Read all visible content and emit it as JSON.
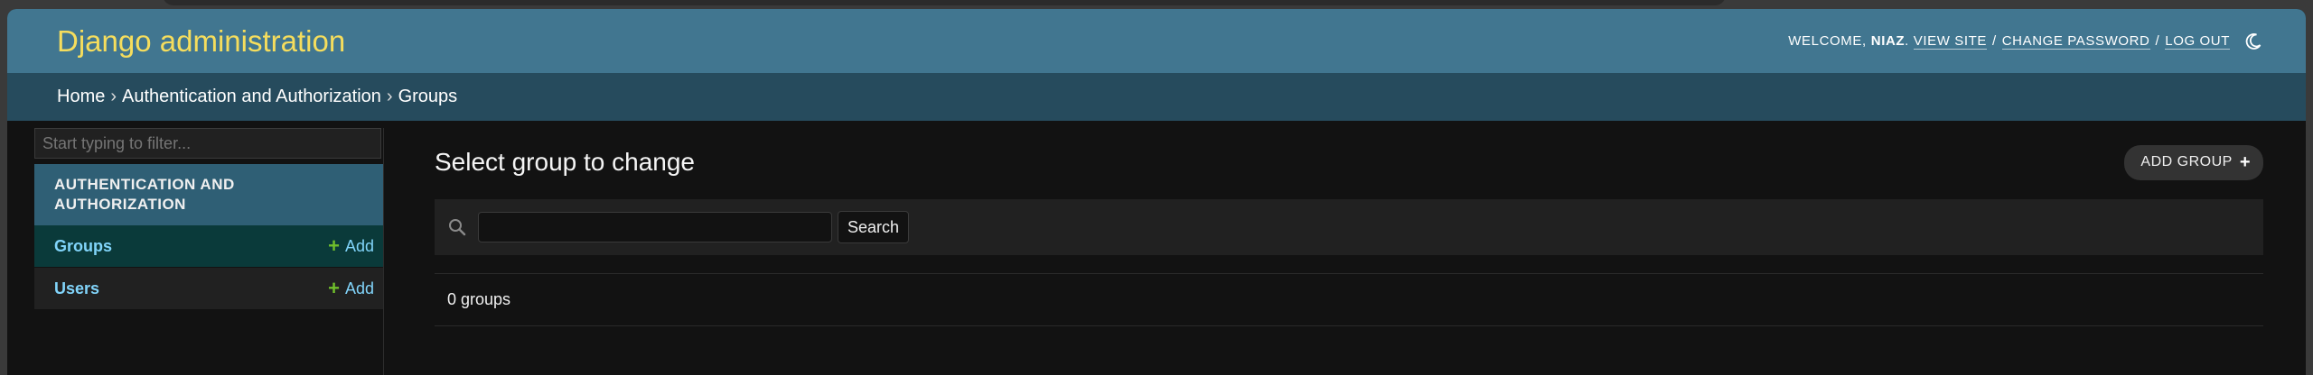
{
  "header": {
    "brand": "Django administration",
    "welcome": "Welcome,",
    "username": "niaz",
    "view_site": "View site",
    "change_password": "Change password",
    "log_out": "Log out",
    "sep1": "/",
    "sep2": "/"
  },
  "breadcrumbs": {
    "home": "Home",
    "app": "Authentication and Authorization",
    "current": "Groups",
    "arrow": "›"
  },
  "sidebar": {
    "filter_placeholder": "Start typing to filter...",
    "module_caption": "Authentication and Authorization",
    "models": [
      {
        "name": "Groups",
        "add_label": "Add",
        "plus": "+"
      },
      {
        "name": "Users",
        "add_label": "Add",
        "plus": "+"
      }
    ]
  },
  "main": {
    "title": "Select group to change",
    "add_button": "Add group",
    "add_plus": "+",
    "search_button": "Search",
    "search_value": "",
    "result_count": "0 groups"
  },
  "colors": {
    "header_bg": "#417690",
    "brand": "#f5dd5d",
    "breadcrumb_bg": "#264b5d",
    "link": "#81d4fa",
    "add_plus": "#70bf2b"
  },
  "icons": {
    "theme_toggle": "moon-icon",
    "search": "search-icon"
  }
}
